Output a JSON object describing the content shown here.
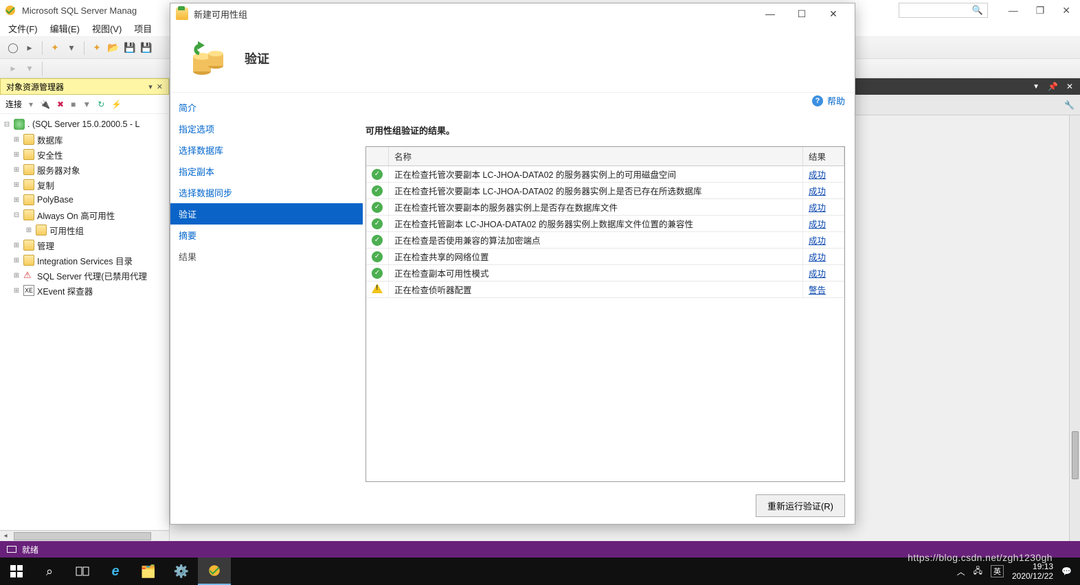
{
  "ssms": {
    "title": "Microsoft SQL Server Manag",
    "menu": [
      "文件(F)",
      "编辑(E)",
      "视图(V)",
      "项目"
    ],
    "object_explorer": {
      "title": "对象资源管理器",
      "connect_label": "连接",
      "root": ". (SQL Server 15.0.2000.5 - L",
      "nodes": [
        {
          "label": "数据库",
          "icon": "folder"
        },
        {
          "label": "安全性",
          "icon": "folder"
        },
        {
          "label": "服务器对象",
          "icon": "folder"
        },
        {
          "label": "复制",
          "icon": "folder"
        },
        {
          "label": "PolyBase",
          "icon": "folder"
        },
        {
          "label": "Always On 高可用性",
          "icon": "folder",
          "expanded": true,
          "children": [
            {
              "label": "可用性组",
              "icon": "folder"
            }
          ]
        },
        {
          "label": "管理",
          "icon": "folder"
        },
        {
          "label": "Integration Services 目录",
          "icon": "folder"
        },
        {
          "label": "SQL Server 代理(已禁用代理",
          "icon": "agent"
        },
        {
          "label": "XEvent 探查器",
          "icon": "xevent"
        }
      ]
    },
    "status": "就绪"
  },
  "dialog": {
    "window_title": "新建可用性组",
    "header": "验证",
    "help": "帮助",
    "nav": [
      {
        "label": "简介",
        "active": false
      },
      {
        "label": "指定选项",
        "active": false
      },
      {
        "label": "选择数据库",
        "active": false
      },
      {
        "label": "指定副本",
        "active": false
      },
      {
        "label": "选择数据同步",
        "active": false
      },
      {
        "label": "验证",
        "active": true
      },
      {
        "label": "摘要",
        "active": false
      },
      {
        "label": "结果",
        "active": false,
        "disabled": true
      }
    ],
    "subtitle": "可用性组验证的结果。",
    "columns": {
      "name": "名称",
      "result": "结果"
    },
    "rows": [
      {
        "status": "ok",
        "name": "正在检查托管次要副本 LC-JHOA-DATA02 的服务器实例上的可用磁盘空间",
        "result": "成功"
      },
      {
        "status": "ok",
        "name": "正在检查托管次要副本 LC-JHOA-DATA02 的服务器实例上是否已存在所选数据库",
        "result": "成功"
      },
      {
        "status": "ok",
        "name": "正在检查托管次要副本的服务器实例上是否存在数据库文件",
        "result": "成功"
      },
      {
        "status": "ok",
        "name": "正在检查托管副本 LC-JHOA-DATA02 的服务器实例上数据库文件位置的兼容性",
        "result": "成功"
      },
      {
        "status": "ok",
        "name": "正在检查是否使用兼容的算法加密端点",
        "result": "成功"
      },
      {
        "status": "ok",
        "name": "正在检查共享的网络位置",
        "result": "成功"
      },
      {
        "status": "ok",
        "name": "正在检查副本可用性模式",
        "result": "成功"
      },
      {
        "status": "warn",
        "name": "正在检查侦听器配置",
        "result": "警告"
      }
    ],
    "rerun": "重新运行验证(R)"
  },
  "taskbar": {
    "time": "19:13",
    "date": "2020/12/22"
  },
  "watermark": "https://blog.csdn.net/zgh1230gh"
}
